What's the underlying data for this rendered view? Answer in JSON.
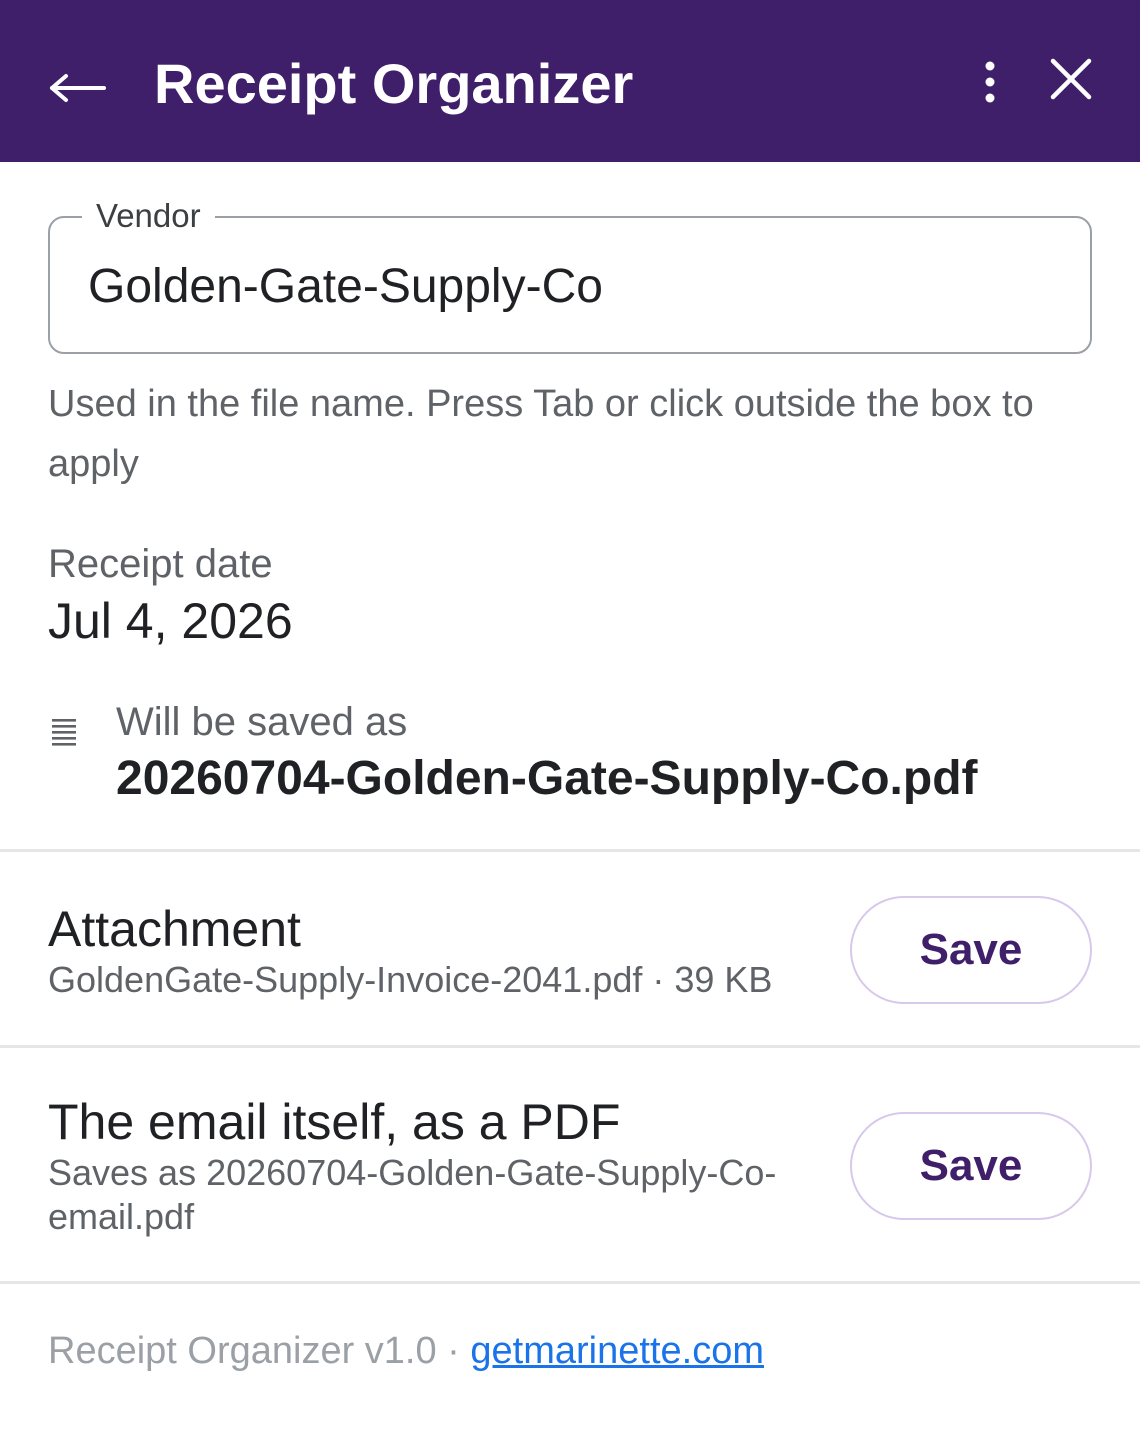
{
  "header": {
    "back_icon": "arrow-left-icon",
    "title": "Receipt Organizer",
    "more_icon": "more-vertical-icon",
    "close_icon": "close-icon",
    "background": "#3f1f69"
  },
  "vendor": {
    "label": "Vendor",
    "value": "Golden-Gate-Supply-Co",
    "helper": "Used in the file name. Press Tab or click outside the box to apply"
  },
  "receipt_date": {
    "label": "Receipt date",
    "value": "Jul 4, 2026"
  },
  "save_as": {
    "icon": "file-lines-icon",
    "label": "Will be saved as",
    "filename": "20260704-Golden-Gate-Supply-Co.pdf"
  },
  "attachment": {
    "title": "Attachment",
    "file": "GoldenGate-Supply-Invoice-2041.pdf · 39 KB",
    "button": "Save"
  },
  "email_pdf": {
    "title": "The email itself, as a PDF",
    "subtitle": "Saves as 20260704-Golden-Gate-Supply-Co-email.pdf",
    "button": "Save"
  },
  "footer": {
    "version": "Receipt Organizer v1.0 · ",
    "link": "getmarinette.com"
  }
}
